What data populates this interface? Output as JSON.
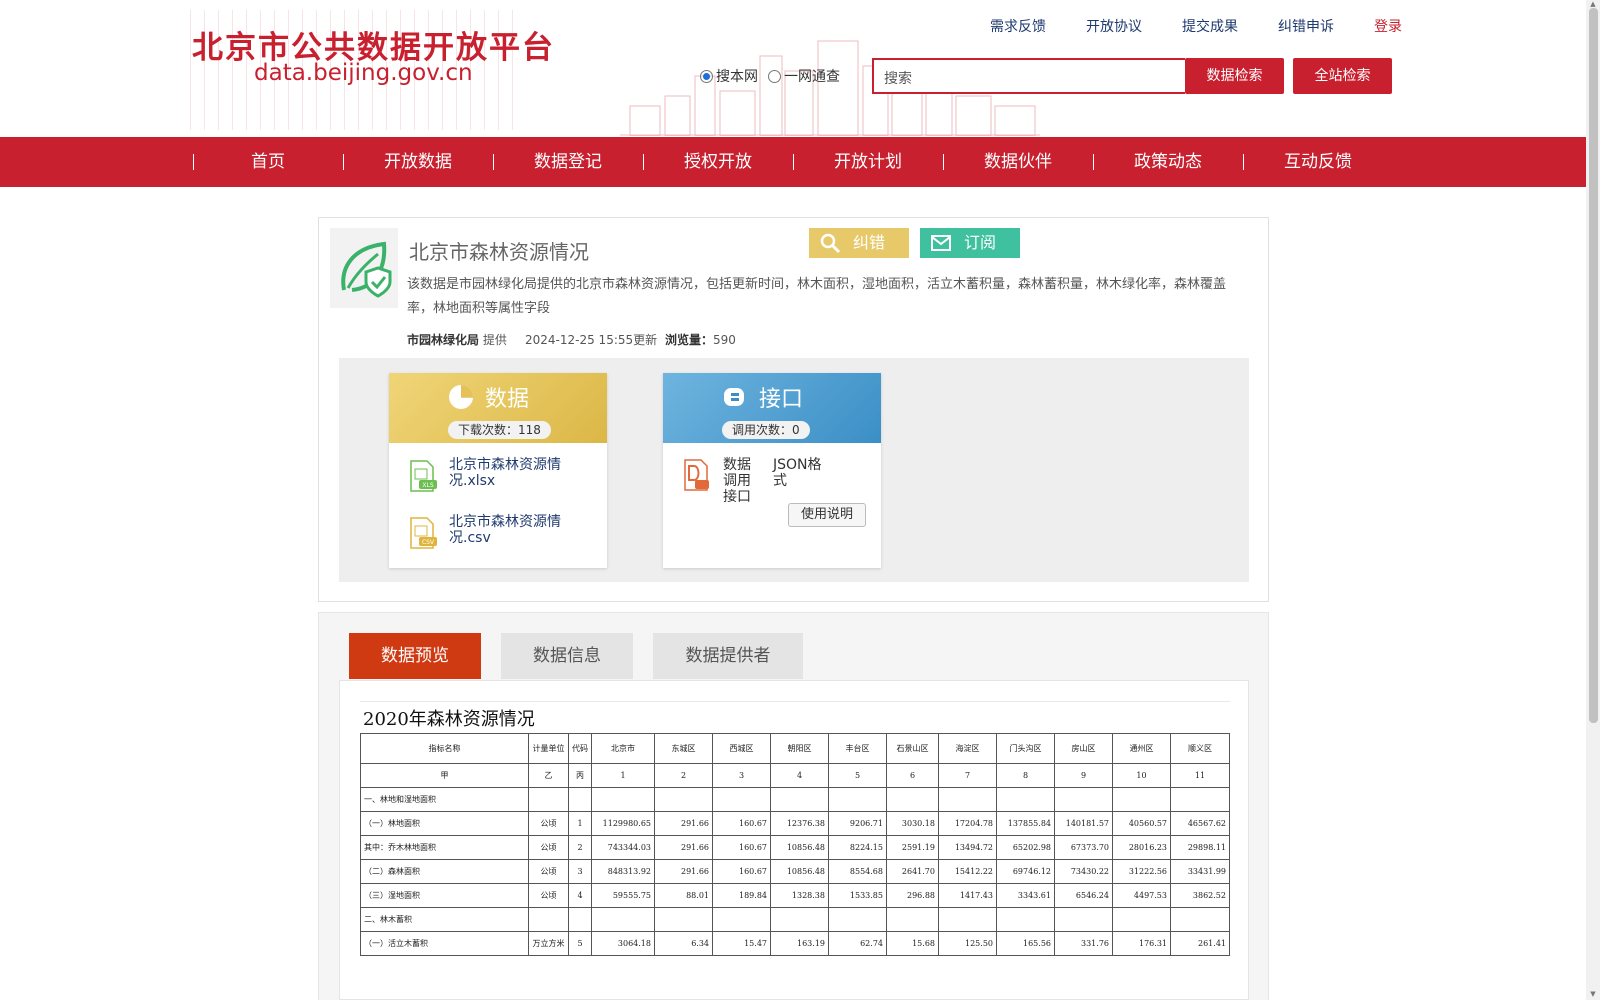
{
  "header": {
    "logo_title": "北京市公共数据开放平台",
    "logo_url": "data.beijing.gov.cn",
    "top_links": [
      "需求反馈",
      "开放协议",
      "提交成果",
      "纠错申诉"
    ],
    "login": "登录",
    "search_scopes": [
      {
        "label": "搜本网",
        "selected": true
      },
      {
        "label": "一网通查",
        "selected": false
      }
    ],
    "search_placeholder": "搜索",
    "search_button": "数据检索",
    "site_search_button": "全站检索"
  },
  "nav": {
    "items": [
      "首页",
      "开放数据",
      "数据登记",
      "授权开放",
      "开放计划",
      "数据伙伴",
      "政策动态",
      "互动反馈"
    ]
  },
  "dataset": {
    "title": "北京市森林资源情况",
    "fix_label": "纠错",
    "subscribe_label": "订阅",
    "description": "该数据是市园林绿化局提供的北京市森林资源情况，包括更新时间，林木面积，湿地面积，活立木蓄积量，森林蓄积量，林木绿化率，森林覆盖率，林地面积等属性字段",
    "provider": "市园林绿化局",
    "provider_suffix": "提供",
    "updated": "2024-12-25 15:55更新",
    "views_label": "浏览量：",
    "views": "590",
    "data_box": {
      "title": "数据",
      "downloads_label": "下载次数：118",
      "files": [
        {
          "name": "北京市森林资源情况.xlsx",
          "type": "XLS"
        },
        {
          "name": "北京市森林资源情况.csv",
          "type": "CSV"
        }
      ]
    },
    "api_box": {
      "title": "接口",
      "calls_label": "调用次数：0",
      "api_name": "数据调用接口",
      "api_format": "JSON格式",
      "usage_button": "使用说明"
    }
  },
  "tabs": {
    "items": [
      "数据预览",
      "数据信息",
      "数据提供者"
    ],
    "active": 0
  },
  "preview": {
    "title": "2020年森林资源情况",
    "header_cols": [
      "指标名称",
      "计量单位",
      "代码",
      "北京市",
      "东城区",
      "西城区",
      "朝阳区",
      "丰台区",
      "石景山区",
      "海淀区",
      "门头沟区",
      "房山区",
      "通州区",
      "顺义区"
    ],
    "index_row": [
      "甲",
      "乙",
      "丙",
      "1",
      "2",
      "3",
      "4",
      "5",
      "6",
      "7",
      "8",
      "9",
      "10",
      "11"
    ],
    "rows": [
      {
        "name": "一、林地和湿地面积",
        "indent": 0,
        "unit": "",
        "code": "",
        "values": [
          "",
          "",
          "",
          "",
          "",
          "",
          "",
          "",
          "",
          "",
          ""
        ]
      },
      {
        "name": "（一）林地面积",
        "indent": 1,
        "unit": "公顷",
        "code": "1",
        "values": [
          "1129980.65",
          "291.66",
          "160.67",
          "12376.38",
          "9206.71",
          "3030.18",
          "17204.78",
          "137855.84",
          "140181.57",
          "40560.57",
          "46567.62"
        ]
      },
      {
        "name": "其中：乔木林地面积",
        "indent": 2,
        "unit": "公顷",
        "code": "2",
        "values": [
          "743344.03",
          "291.66",
          "160.67",
          "10856.48",
          "8224.15",
          "2591.19",
          "13494.72",
          "65202.98",
          "67373.70",
          "28016.23",
          "29898.11"
        ]
      },
      {
        "name": "（二）森林面积",
        "indent": 1,
        "unit": "公顷",
        "code": "3",
        "values": [
          "848313.92",
          "291.66",
          "160.67",
          "10856.48",
          "8554.68",
          "2641.70",
          "15412.22",
          "69746.12",
          "73430.22",
          "31222.56",
          "33431.99"
        ]
      },
      {
        "name": "（三）湿地面积",
        "indent": 1,
        "unit": "公顷",
        "code": "4",
        "values": [
          "59555.75",
          "88.01",
          "189.84",
          "1328.38",
          "1533.85",
          "296.88",
          "1417.43",
          "3343.61",
          "6546.24",
          "4497.53",
          "3862.52"
        ]
      },
      {
        "name": "二、林木蓄积",
        "indent": 0,
        "unit": "",
        "code": "",
        "values": [
          "",
          "",
          "",
          "",
          "",
          "",
          "",
          "",
          "",
          "",
          ""
        ]
      },
      {
        "name": "（一）活立木蓄积",
        "indent": 1,
        "unit": "万立方米",
        "code": "5",
        "values": [
          "3064.18",
          "6.34",
          "15.47",
          "163.19",
          "62.74",
          "15.68",
          "125.50",
          "165.56",
          "331.76",
          "176.31",
          "261.41"
        ]
      }
    ]
  },
  "colors": {
    "brand_red": "#c8202f",
    "active_tab": "#cf3a12",
    "fix_gold": "#e8c96a",
    "subscribe_green": "#3fc09e"
  },
  "icons": [
    "leaf-shield-icon",
    "magnifier-icon",
    "mail-icon",
    "pie-chart-icon",
    "api-cloud-icon",
    "xls-file-icon",
    "csv-file-icon",
    "api-doc-icon"
  ]
}
